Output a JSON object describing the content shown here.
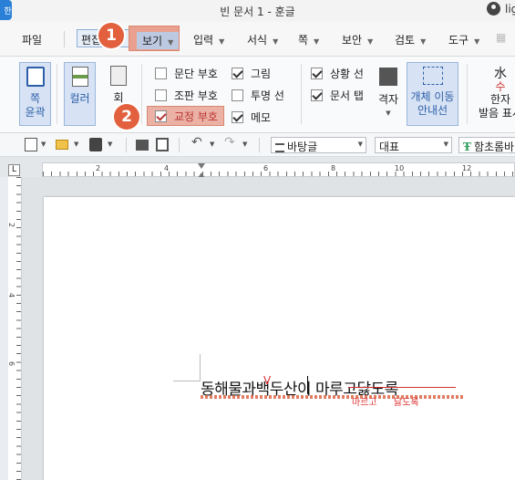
{
  "window": {
    "app_badge": "한",
    "title": "빈 문서 1 - 훈글",
    "user": "lig"
  },
  "menu": {
    "file": "파일",
    "edit": "편집",
    "view": "보기",
    "input": "입력",
    "format": "서식",
    "page": "쪽",
    "security": "보안",
    "review": "검토",
    "tools": "도구"
  },
  "ribbon": {
    "outline_line1": "쪽",
    "outline_line2": "윤곽",
    "color": "컬러",
    "gray": "회",
    "checkboxes": {
      "paragraph_mark": {
        "label": "문단 부호",
        "checked": false
      },
      "layout_mark": {
        "label": "조판 부호",
        "checked": false
      },
      "fixed_mark": {
        "label": "교정 부호",
        "checked": true
      },
      "picture": {
        "label": "그림",
        "checked": true
      },
      "transparent_line": {
        "label": "투명 선",
        "checked": false
      },
      "memo": {
        "label": "메모",
        "checked": true
      },
      "status_bar": {
        "label": "상황 선",
        "checked": true
      },
      "doc_tab": {
        "label": "문서 탭",
        "checked": true
      }
    },
    "grid": "격자",
    "object_move_line1": "개체 이동",
    "object_move_line2": "안내선",
    "hanja_line1": "한자",
    "hanja_line2": "발음 표시",
    "hanja_icon_top": "水",
    "hanja_icon_bottom": "수"
  },
  "toolbar": {
    "style": "바탕글",
    "language": "대표",
    "font": "함초롬바"
  },
  "ruler": {
    "corner": "L",
    "h_numbers": [
      "2",
      "4",
      "6",
      "8",
      "10",
      "12"
    ],
    "v_numbers": [
      "2",
      "4",
      "6"
    ]
  },
  "document": {
    "text": "동해물과백두산이 마루고닳도록",
    "suggestion_1": "마르고",
    "suggestion_2": "닳도록",
    "insert_mark": "V"
  },
  "callouts": {
    "one": "1",
    "two": "2"
  },
  "colors": {
    "highlight": "#eab1a4",
    "callout": "#e2603d",
    "accent_blue": "#2c5ea8"
  }
}
